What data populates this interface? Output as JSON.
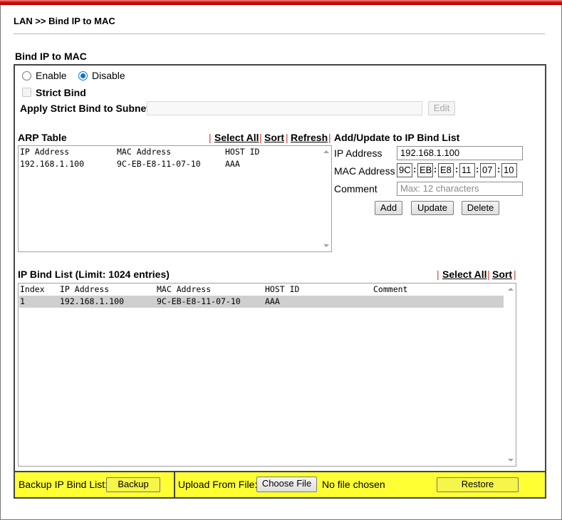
{
  "breadcrumb": "LAN >> Bind IP to MAC",
  "section_title": "Bind IP to MAC",
  "mode": {
    "enable_label": "Enable",
    "disable_label": "Disable",
    "selected": "Disable"
  },
  "strict_bind": {
    "label": "Strict Bind",
    "checked": false
  },
  "subnet": {
    "label": "Apply Strict Bind to Subnet",
    "value": "",
    "edit_label": "Edit"
  },
  "arp_table": {
    "title": "ARP Table",
    "actions": {
      "select_all": "Select All",
      "sort": "Sort",
      "refresh": "Refresh"
    },
    "columns": [
      "IP Address",
      "MAC Address",
      "HOST ID"
    ],
    "rows": [
      [
        "192.168.1.100",
        "9C-EB-E8-11-07-10",
        "AAA"
      ]
    ]
  },
  "add_update": {
    "title": "Add/Update to IP Bind List",
    "ip_label": "IP Address",
    "ip_value": "192.168.1.100",
    "mac_label": "MAC Address",
    "mac_parts": [
      "9C",
      "EB",
      "E8",
      "11",
      "07",
      "10"
    ],
    "comment_label": "Comment",
    "comment_placeholder": "Max: 12 characters",
    "buttons": {
      "add": "Add",
      "update": "Update",
      "delete": "Delete"
    }
  },
  "bind_list": {
    "title": "IP Bind List (Limit: 1024 entries)",
    "actions": {
      "select_all": "Select All",
      "sort": "Sort"
    },
    "columns": [
      "Index",
      "IP Address",
      "MAC Address",
      "HOST ID",
      "Comment"
    ],
    "rows": [
      [
        "1",
        "192.168.1.100",
        "9C-EB-E8-11-07-10",
        "AAA",
        ""
      ]
    ]
  },
  "footer": {
    "backup_label": "Backup IP Bind List:",
    "backup_button": "Backup",
    "upload_label": "Upload From File:",
    "choose_file_button": "Choose File",
    "file_status": "No file chosen",
    "restore_button": "Restore"
  },
  "colors": {
    "accent_red": "#c00000",
    "footer_yellow": "#ffff33",
    "radio_blue": "#0a74d8",
    "separator_red": "#e03030"
  }
}
